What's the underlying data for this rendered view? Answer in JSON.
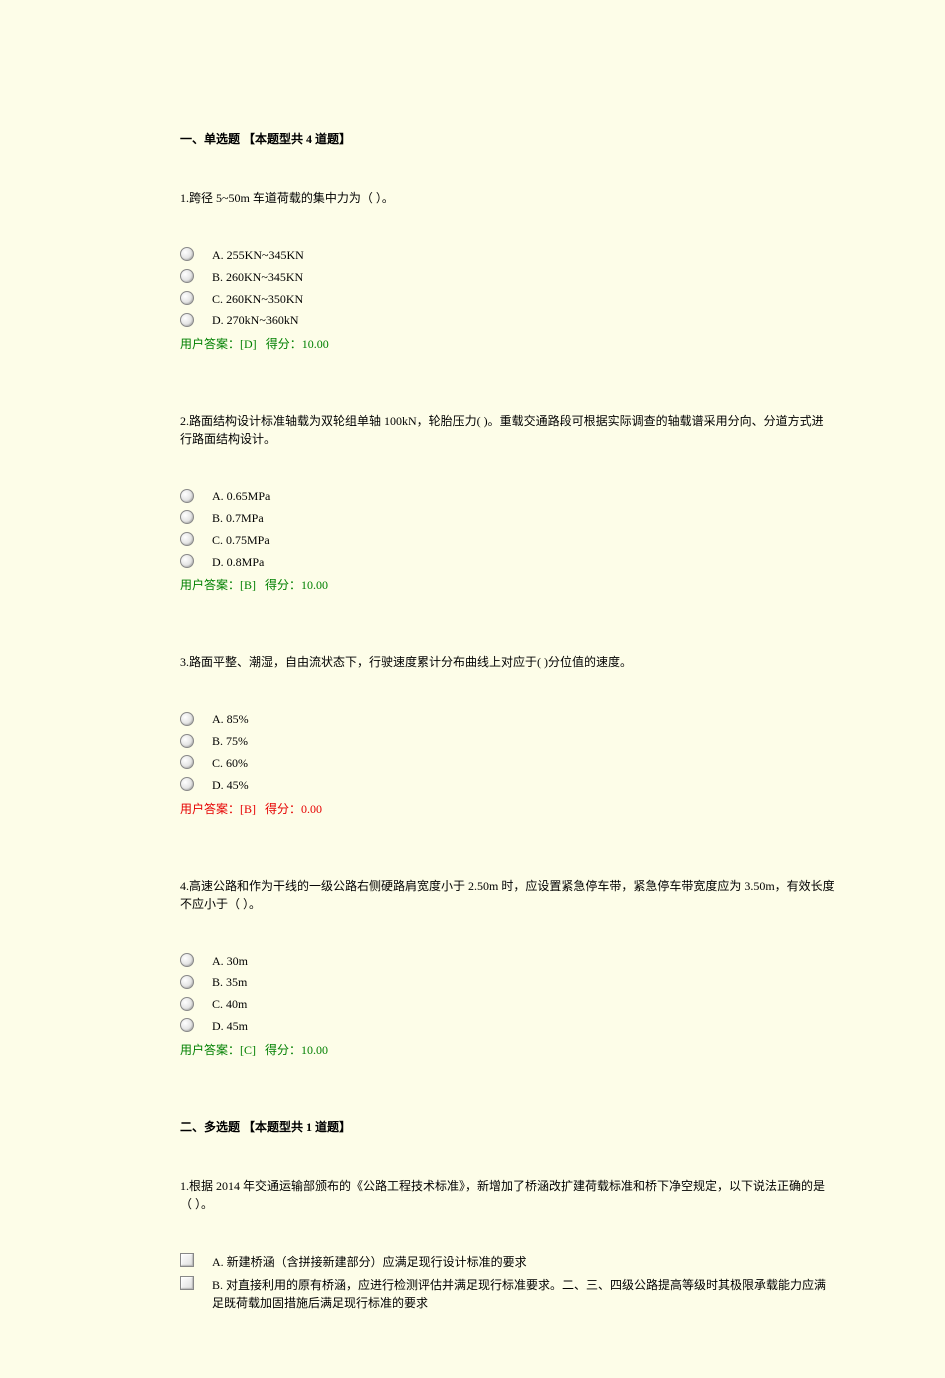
{
  "section1": {
    "title": "一、单选题 【本题型共 4 道题】",
    "questions": [
      {
        "text": "1.跨径 5~50m 车道荷载的集中力为（ ）。",
        "options": [
          {
            "label": "A.  255KN~345KN"
          },
          {
            "label": "B.  260KN~345KN"
          },
          {
            "label": "C.  260KN~350KN"
          },
          {
            "label": "D.  270kN~360kN"
          }
        ],
        "answer_prefix": "用户答案：",
        "answer_value": "[D]",
        "score_prefix": "得分：",
        "score_value": "10.00",
        "status": "correct"
      },
      {
        "text": "2.路面结构设计标准轴载为双轮组单轴 100kN，轮胎压力(   )。重载交通路段可根据实际调查的轴载谱采用分向、分道方式进行路面结构设计。",
        "options": [
          {
            "label": "A.  0.65MPa"
          },
          {
            "label": "B.  0.7MPa"
          },
          {
            "label": "C.  0.75MPa"
          },
          {
            "label": "D.  0.8MPa"
          }
        ],
        "answer_prefix": "用户答案：",
        "answer_value": "[B]",
        "score_prefix": "得分：",
        "score_value": "10.00",
        "status": "correct"
      },
      {
        "text": "3.路面平整、潮湿，自由流状态下，行驶速度累计分布曲线上对应于(   )分位值的速度。",
        "options": [
          {
            "label": "A.  85%"
          },
          {
            "label": "B.  75%"
          },
          {
            "label": "C.  60%"
          },
          {
            "label": "D.  45%"
          }
        ],
        "answer_prefix": "用户答案：",
        "answer_value": "[B]",
        "score_prefix": "得分：",
        "score_value": "0.00",
        "status": "wrong"
      },
      {
        "text": "4.高速公路和作为干线的一级公路右侧硬路肩宽度小于 2.50m 时，应设置紧急停车带，紧急停车带宽度应为 3.50m，有效长度不应小于（ ）。",
        "options": [
          {
            "label": "A.  30m"
          },
          {
            "label": "B.  35m"
          },
          {
            "label": "C.  40m"
          },
          {
            "label": "D.  45m"
          }
        ],
        "answer_prefix": "用户答案：",
        "answer_value": "[C]",
        "score_prefix": "得分：",
        "score_value": "10.00",
        "status": "correct"
      }
    ]
  },
  "section2": {
    "title": "二、多选题 【本题型共 1 道题】",
    "questions": [
      {
        "text": "1.根据 2014 年交通运输部颁布的《公路工程技术标准》，新增加了桥涵改扩建荷载标准和桥下净空规定，以下说法正确的是（   ）。",
        "options": [
          {
            "label": "A.  新建桥涵（含拼接新建部分）应满足现行设计标准的要求"
          },
          {
            "label": "B.  对直接利用的原有桥涵，应进行检测评估并满足现行标准要求。二、三、四级公路提高等级时其极限承载能力应满足既荷载加固措施后满足现行标准的要求"
          }
        ]
      }
    ]
  }
}
